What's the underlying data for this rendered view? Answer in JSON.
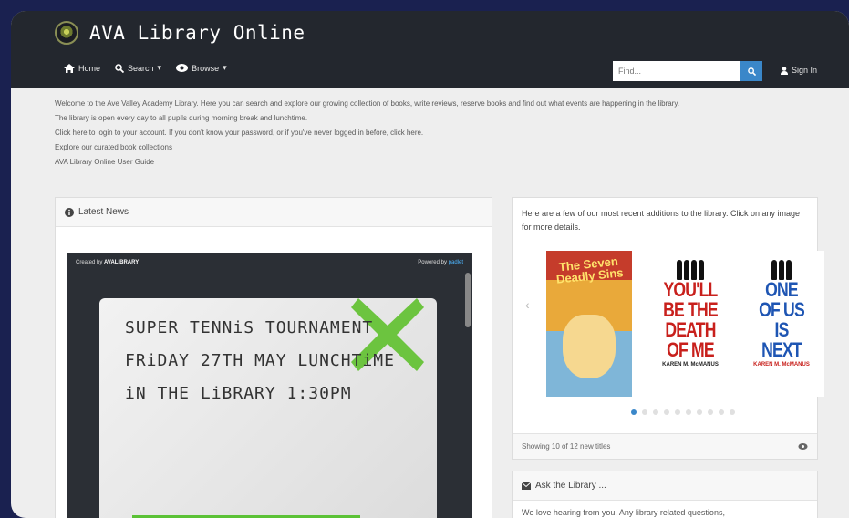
{
  "app": {
    "title": "AVA Library Online"
  },
  "nav": {
    "home": "Home",
    "search": "Search",
    "browse": "Browse"
  },
  "search": {
    "placeholder": "Find..."
  },
  "signin": "Sign In",
  "intro": [
    "Welcome to the Ave Valley Academy Library. Here you can search and explore our growing collection of books, write reviews, reserve books and find out what events are happening in the library.",
    "The library is open every day to all pupils during morning break and lunchtime.",
    "Click here to login to your account. If you don't know your password, or if you've never logged in before, click here.",
    "Explore our curated book collections",
    "AVA Library Online User Guide"
  ],
  "news": {
    "heading": "Latest News",
    "embed_created": "Created by",
    "embed_creator": "AVALIBRARY",
    "embed_powered": "Powered by",
    "embed_brand": "padlet",
    "poster_lines": [
      "SUPER TENNiS TOURNAMENT",
      "FRiDAY 27TH MAY LUNCHTiME",
      "iN THE LiBRARY 1:30PM"
    ]
  },
  "books": {
    "intro": "Here are a few of our most recent additions to the library. Click on any image for more details.",
    "covers": [
      {
        "title": "The Seven Deadly Sins"
      },
      {
        "line1": "YOU'LL",
        "line2": "BE THE",
        "line3": "DEATH",
        "line4": "OF ME",
        "author": "KAREN M. McMANUS"
      },
      {
        "line1": "ONE",
        "line2": "OF US",
        "line3": "IS",
        "line4": "NEXT",
        "author": "KAREN M. McMANUS"
      }
    ],
    "footer": "Showing 10 of 12 new titles"
  },
  "ask": {
    "heading": "Ask the Library ...",
    "body": "We love hearing from you. Any library related questions,"
  },
  "colors": {
    "header": "#23272e",
    "accent": "#3a87c9",
    "background": "#1a2150"
  }
}
